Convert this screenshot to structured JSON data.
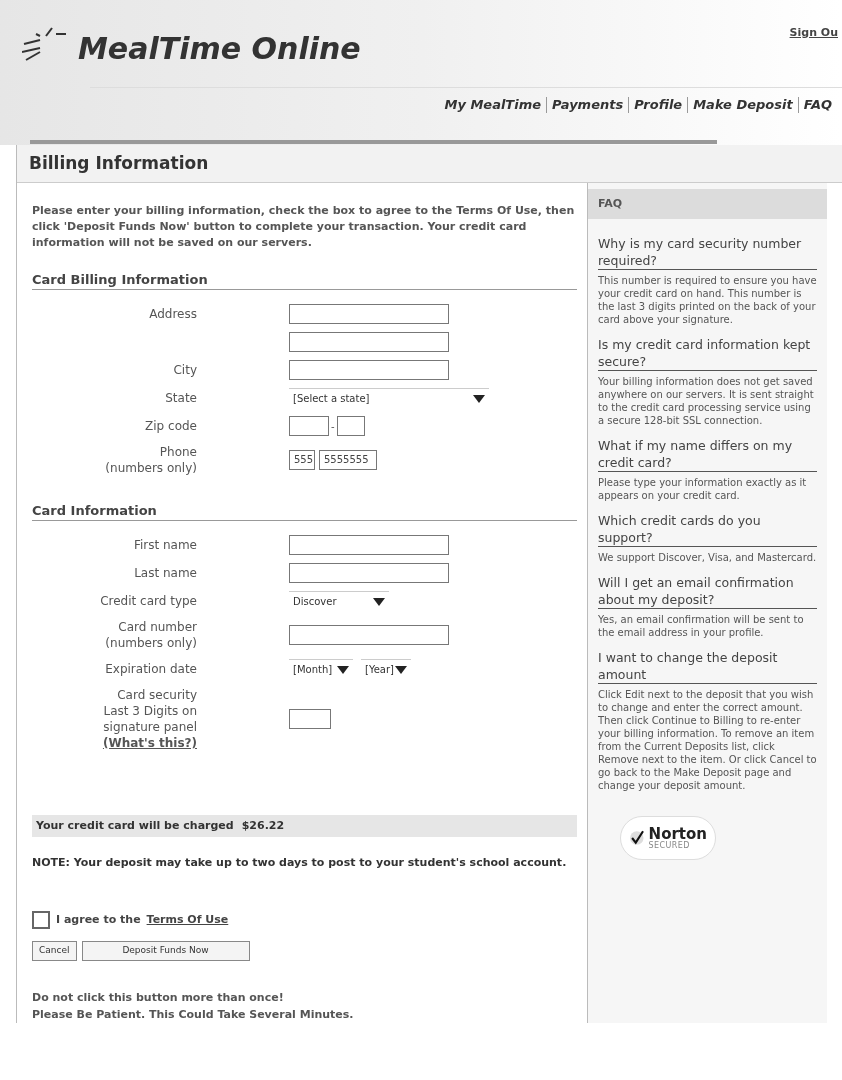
{
  "header": {
    "logo": "MealTime Online",
    "sign_out": "Sign Ou",
    "nav": [
      "My MealTime",
      "Payments",
      "Profile",
      "Make Deposit",
      "FAQ"
    ]
  },
  "page_title": "Billing Information",
  "intro": "Please enter your billing information, check the box to agree to the Terms Of Use, then click 'Deposit Funds Now' button to complete your transaction. Your credit card information will not be saved on our servers.",
  "sections": [
    {
      "title": "Card Billing Information",
      "fields": [
        {
          "kind": "text",
          "label": [
            "Address"
          ]
        },
        {
          "kind": "text"
        },
        {
          "kind": "text",
          "label": [
            "City"
          ]
        },
        {
          "kind": "select",
          "label": [
            "State"
          ],
          "value": "[Select a state]"
        },
        {
          "kind": "zip",
          "label": [
            "Zip code"
          ],
          "separator": "-"
        },
        {
          "kind": "phone",
          "label": [
            "Phone",
            "(numbers only)"
          ],
          "area": "555",
          "number": "5555555"
        }
      ]
    },
    {
      "title": "Card Information",
      "fields": [
        {
          "kind": "text",
          "label": [
            "First name"
          ]
        },
        {
          "kind": "text",
          "label": [
            "Last name"
          ]
        },
        {
          "kind": "select",
          "label": [
            "Credit card type"
          ],
          "value": "Discover"
        },
        {
          "kind": "text",
          "label": [
            "Card number",
            "(numbers only)"
          ]
        },
        {
          "kind": "expiry",
          "label": [
            "Expiration date"
          ],
          "month": "[Month]",
          "year": "[Year]"
        },
        {
          "kind": "code",
          "label": [
            "Card security",
            "Last 3 Digits on",
            "signature panel"
          ],
          "link": "(What's this?)"
        }
      ]
    }
  ],
  "charge": {
    "label": "Your credit card will be charged",
    "amount": "$26.22"
  },
  "note": "NOTE: Your deposit may take up to two days to post to your student's school account.",
  "agree": {
    "checked": false,
    "text": "I agree to the",
    "link": "Terms Of Use"
  },
  "buttons": [
    "Cancel",
    "Deposit Funds Now"
  ],
  "warnings": [
    "Do not click this button more than once!",
    "Please Be Patient. This Could Take Several Minutes."
  ],
  "faq": {
    "title": "FAQ",
    "items": [
      {
        "question": "Why is my card security number required?",
        "answer": "This number is required to ensure you have your credit card on hand. This number is the last 3 digits printed on the back of your card above your signature."
      },
      {
        "question": "Is my credit card information kept secure?",
        "answer": "Your billing information does not get saved anywhere on our servers. It is sent straight to the credit card processing service using a secure 128-bit SSL connection."
      },
      {
        "question": "What if my name differs on my credit card?",
        "answer": "Please type your information exactly as it appears on your credit card."
      },
      {
        "question": "Which credit cards do you support?",
        "answer": "We support Discover, Visa, and Mastercard."
      },
      {
        "question": "Will I get an email confirmation about my deposit?",
        "answer": "Yes, an email confirmation will be sent to the email address in your profile."
      },
      {
        "question": "I want to change the deposit amount",
        "answer": "Click Edit next to the deposit that you wish to change and enter the correct amount. Then click Continue to Billing to re-enter your billing information. To remove an item from the Current Deposits list, click Remove next to the item. Or click Cancel to go back to the Make Deposit page and change your deposit amount."
      }
    ]
  },
  "badge": {
    "name": "Norton",
    "tagline": "SECURED"
  }
}
